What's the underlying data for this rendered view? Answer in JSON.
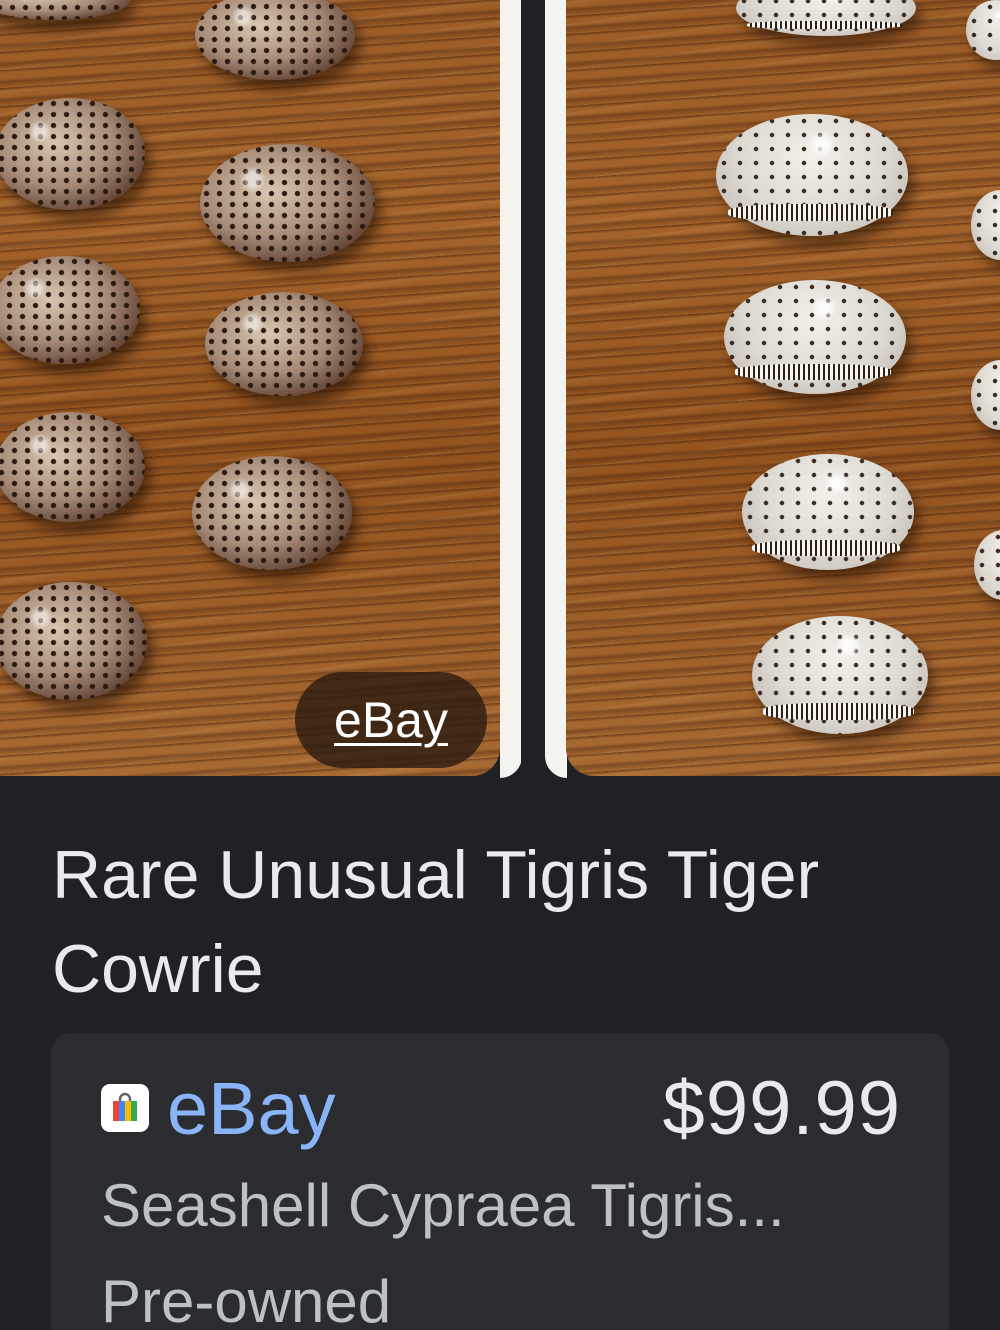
{
  "carousel": {
    "images": [
      {
        "alt_icon": "dark-tiger-cowrie-shells-photo"
      },
      {
        "alt_icon": "light-tiger-cowrie-shells-photo"
      }
    ],
    "watermark": "eBay"
  },
  "listing": {
    "title": "Rare Unusual Tigris Tiger Cowrie",
    "store_icon": "shopping-bag-icon",
    "store": "eBay",
    "price": "$99.99",
    "subtitle": "Seashell Cypraea Tigris...",
    "condition": "Pre-owned"
  },
  "colors": {
    "background": "#202124",
    "card": "#2b2c2f",
    "store_link": "#8ab4f8",
    "text_primary": "#e8eaed",
    "text_secondary": "#bdc1c6"
  }
}
